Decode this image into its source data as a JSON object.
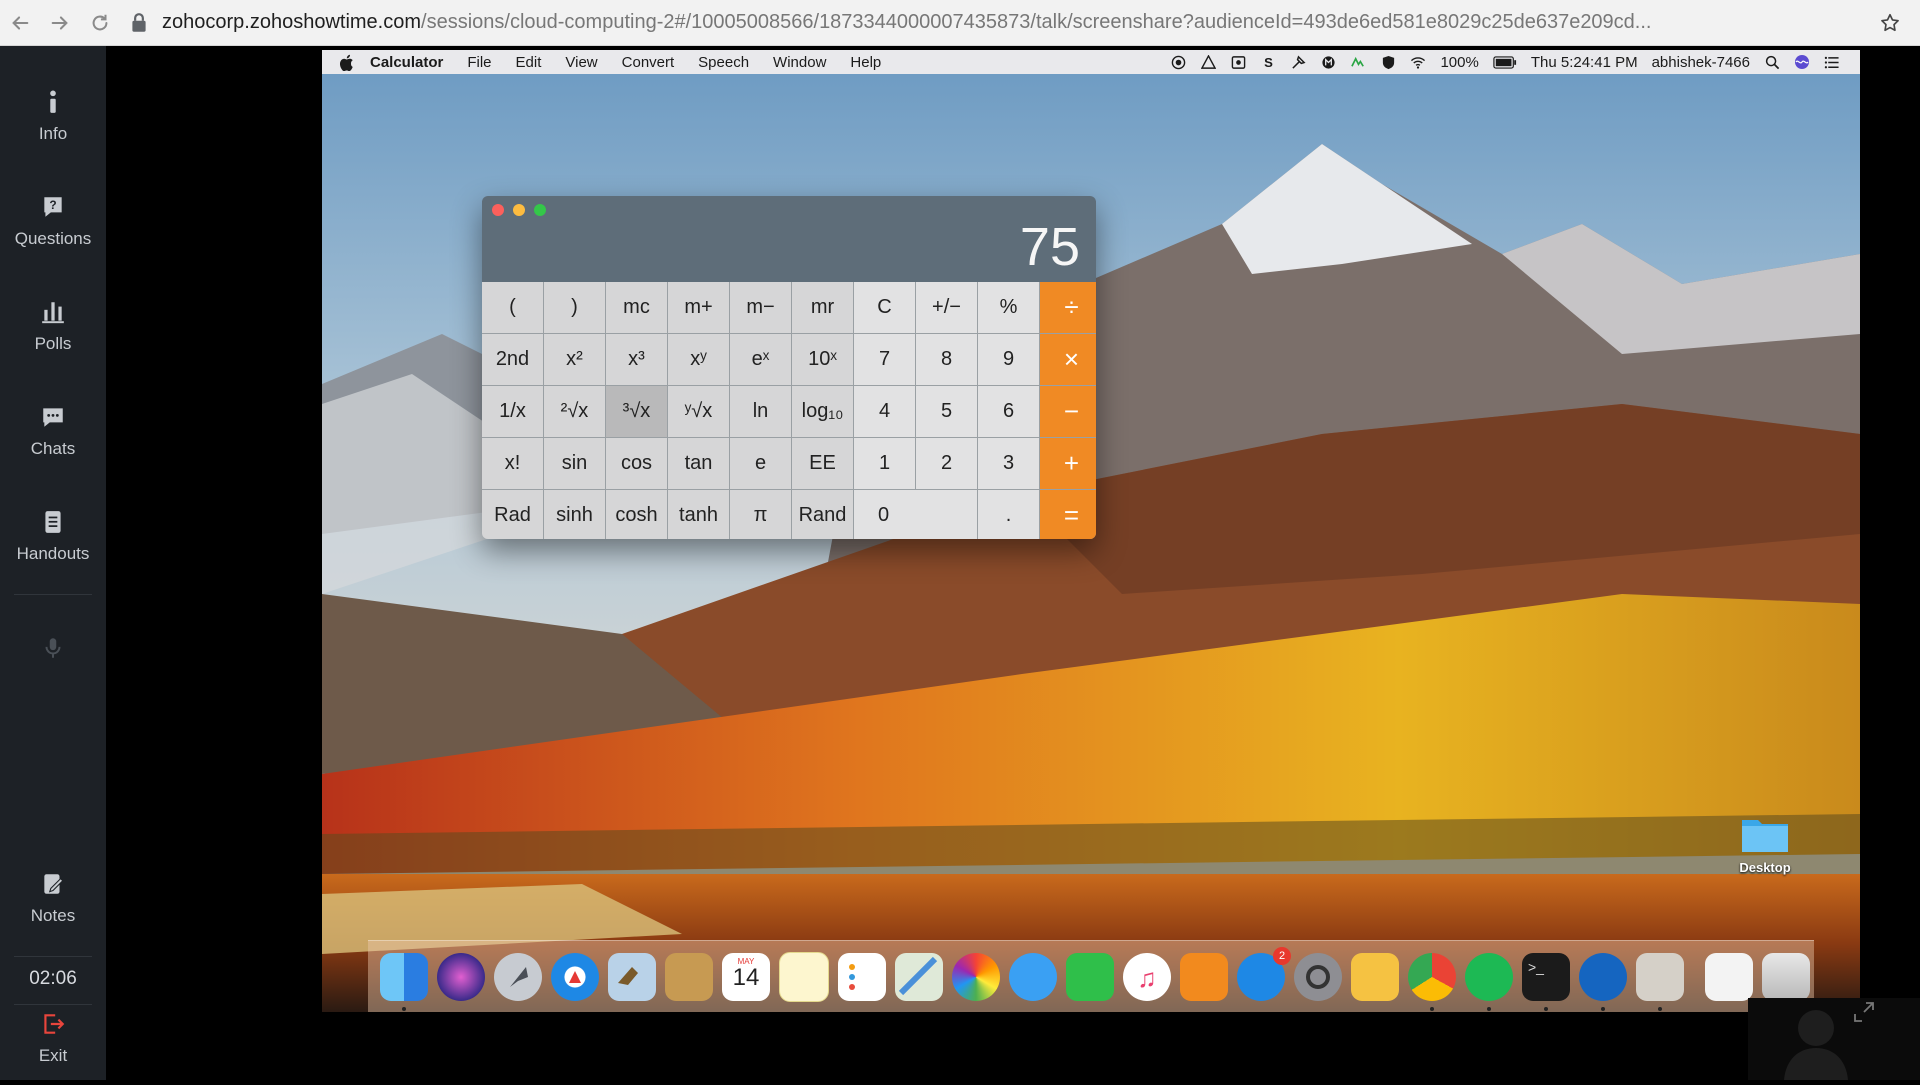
{
  "browser": {
    "url_host": "zohocorp.zohoshowtime.com",
    "url_path": "/sessions/cloud-computing-2#/10005008566/1873344000007435873/talk/screenshare?audienceId=493de6ed581e8029c25de637e209cd..."
  },
  "sidebar": {
    "items": [
      {
        "label": "Info",
        "icon": "info-icon"
      },
      {
        "label": "Questions",
        "icon": "question-icon"
      },
      {
        "label": "Polls",
        "icon": "bar-chart-icon"
      },
      {
        "label": "Chats",
        "icon": "chat-icon"
      },
      {
        "label": "Handouts",
        "icon": "document-icon"
      }
    ],
    "mic_icon": "microphone-icon",
    "notes_label": "Notes",
    "timer": "02:06",
    "exit_label": "Exit"
  },
  "mac": {
    "menubar": {
      "app": "Calculator",
      "menus": [
        "File",
        "Edit",
        "View",
        "Convert",
        "Speech",
        "Window",
        "Help"
      ],
      "battery": "100%",
      "clock": "Thu 5:24:41 PM",
      "user": "abhishek-7466"
    },
    "calculator": {
      "display": "75",
      "keys": {
        "r1": [
          "(",
          ")",
          "mc",
          "m+",
          "m−",
          "mr",
          "C",
          "+/−",
          "%",
          "÷"
        ],
        "r2": [
          "2nd",
          "x²",
          "x³",
          "xʸ",
          "eˣ",
          "10ˣ",
          "7",
          "8",
          "9",
          "×"
        ],
        "r3": [
          "1/x",
          "²√x",
          "³√x",
          "ʸ√x",
          "ln",
          "log₁₀",
          "4",
          "5",
          "6",
          "−"
        ],
        "r4": [
          "x!",
          "sin",
          "cos",
          "tan",
          "e",
          "EE",
          "1",
          "2",
          "3",
          "+"
        ],
        "r5": [
          "Rad",
          "sinh",
          "cosh",
          "tanh",
          "π",
          "Rand",
          "0",
          ".",
          "="
        ]
      }
    },
    "desktop_folder": "Desktop",
    "dock": {
      "calendar_month": "MAY",
      "calendar_day": "14",
      "appstore_badge": "2"
    }
  },
  "colors": {
    "calc_header": "#5e6d79",
    "calc_operator": "#f08a24",
    "sidebar_bg": "#1d2126"
  }
}
